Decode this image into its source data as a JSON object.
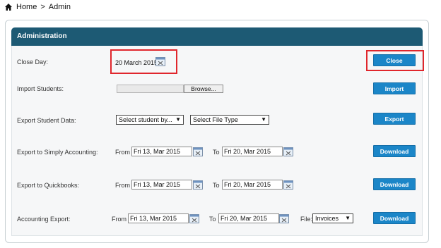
{
  "breadcrumb": {
    "home": "Home",
    "separator": ">",
    "current": "Admin"
  },
  "panel": {
    "title": "Administration"
  },
  "rows": {
    "close_day": {
      "label": "Close  Day:",
      "date": "20 March 2015",
      "button": "Close"
    },
    "import_students": {
      "label": "Import Students:",
      "browse": "Browse...",
      "button": "Import"
    },
    "export_student_data": {
      "label": "Export Student Data:",
      "select_student": "Select student by...",
      "select_file": "Select File Type",
      "button": "Export"
    },
    "export_simply": {
      "label": "Export to Simply Accounting:",
      "from_label": "From",
      "from": "Fri 13, Mar 2015",
      "to_label": "To",
      "to": "Fri 20, Mar 2015",
      "button": "Download"
    },
    "export_quickbooks": {
      "label": "Export to Quickbooks:",
      "from_label": "From",
      "from": "Fri 13, Mar 2015",
      "to_label": "To",
      "to": "Fri 20, Mar 2015",
      "button": "Download"
    },
    "accounting_export": {
      "label": "Accounting Export:",
      "from_label": "From",
      "from": "Fri 13, Mar 2015",
      "to_label": "To",
      "to": "Fri 20, Mar 2015",
      "file_label": "File:",
      "file_value": "Invoices",
      "button": "Download"
    }
  },
  "colors": {
    "header": "#1d5a74",
    "button": "#1b86c8",
    "highlight": "#e0262c"
  }
}
